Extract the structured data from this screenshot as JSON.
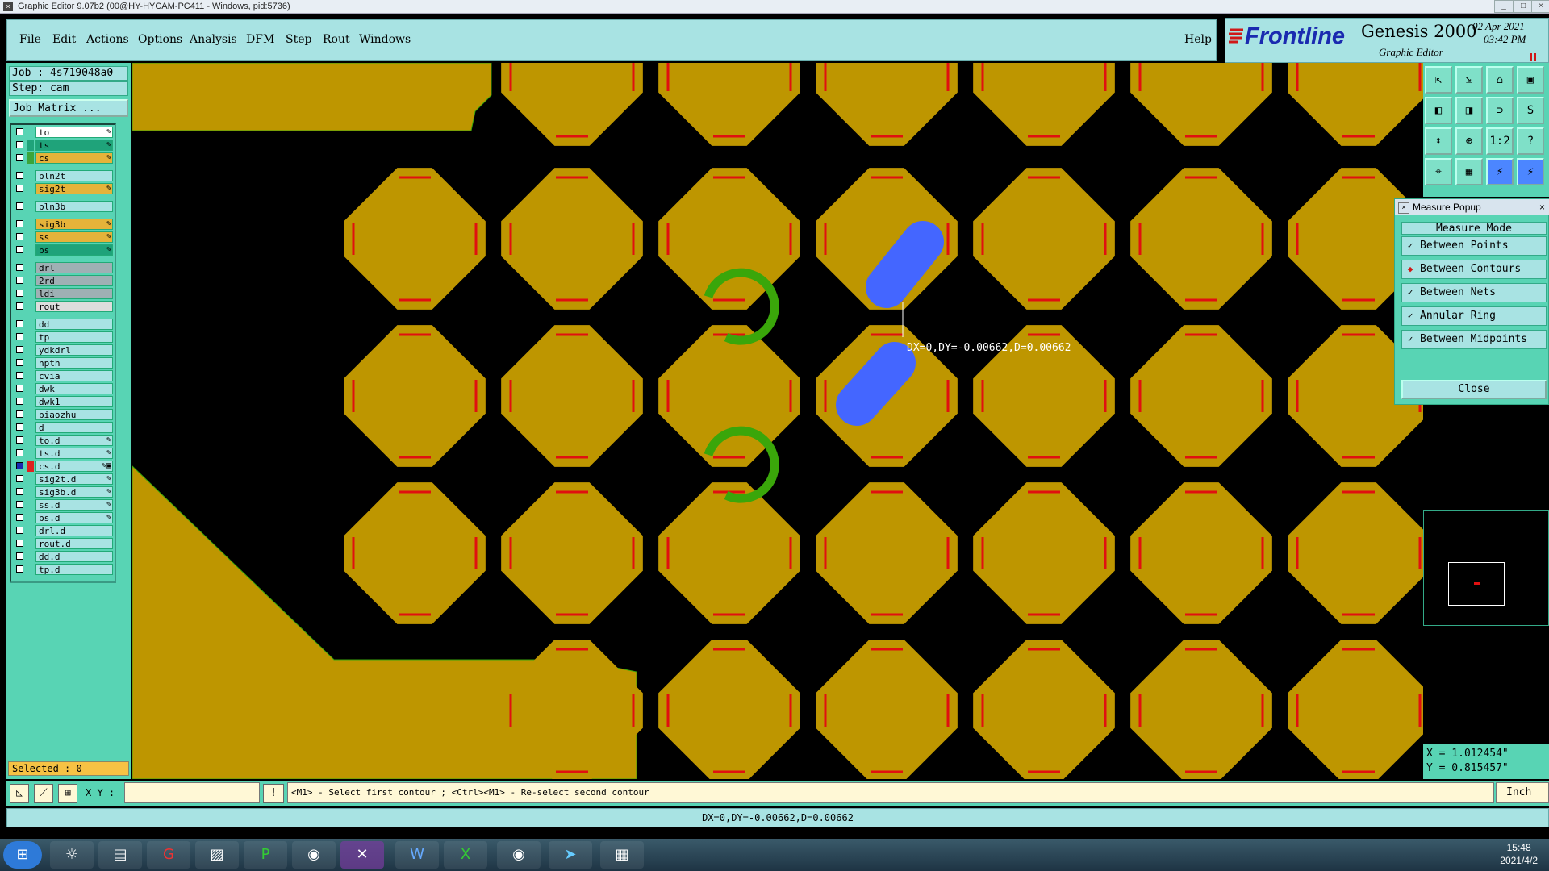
{
  "titlebar": {
    "title": "Graphic Editor 9.07b2 (00@HY-HYCAM-PC411 - Windows, pid:5736)"
  },
  "menu": [
    "File",
    "Edit",
    "Actions",
    "Options",
    "Analysis",
    "DFM",
    "Step",
    "Rout",
    "Windows"
  ],
  "help_label": "Help",
  "logo": {
    "brand": "Frontline",
    "product": "Genesis 2000",
    "subtitle": "Graphic Editor",
    "date": "02 Apr 2021",
    "time": "03:42 PM"
  },
  "job": {
    "job_line": "Job : 4s719048a0",
    "step_line": "Step: cam",
    "matrix_button": "Job Matrix ..."
  },
  "layers": [
    {
      "name": "to",
      "bg": "#ffffff",
      "swatch": "",
      "mark": "✎"
    },
    {
      "name": "ts",
      "bg": "#1fa37a",
      "swatch": "#1fa37a",
      "mark": "✎"
    },
    {
      "name": "cs",
      "bg": "#e5b33a",
      "swatch": "#3aa53a",
      "mark": "✎"
    },
    {
      "name": "pln2t",
      "bg": "#a8e3e3",
      "swatch": "",
      "mark": ""
    },
    {
      "name": "sig2t",
      "bg": "#e5b33a",
      "swatch": "",
      "mark": "✎"
    },
    {
      "name": "pln3b",
      "bg": "#a8e3e3",
      "swatch": "",
      "mark": ""
    },
    {
      "name": "sig3b",
      "bg": "#e5b33a",
      "swatch": "",
      "mark": "✎"
    },
    {
      "name": "ss",
      "bg": "#e5b33a",
      "swatch": "",
      "mark": "✎"
    },
    {
      "name": "bs",
      "bg": "#1fa37a",
      "swatch": "",
      "mark": "✎"
    },
    {
      "name": "drl",
      "bg": "#9fb0b4",
      "swatch": "",
      "mark": ""
    },
    {
      "name": "2rd",
      "bg": "#9fb0b4",
      "swatch": "",
      "mark": ""
    },
    {
      "name": "ldi",
      "bg": "#9fb0b4",
      "swatch": "",
      "mark": ""
    },
    {
      "name": "rout",
      "bg": "#dddddd",
      "swatch": "",
      "mark": ""
    },
    {
      "name": "dd",
      "bg": "#a8e3e3",
      "swatch": "",
      "mark": ""
    },
    {
      "name": "tp",
      "bg": "#a8e3e3",
      "swatch": "",
      "mark": ""
    },
    {
      "name": "ydkdrl",
      "bg": "#a8e3e3",
      "swatch": "",
      "mark": ""
    },
    {
      "name": "npth",
      "bg": "#a8e3e3",
      "swatch": "",
      "mark": ""
    },
    {
      "name": "cvia",
      "bg": "#a8e3e3",
      "swatch": "",
      "mark": ""
    },
    {
      "name": "dwk",
      "bg": "#a8e3e3",
      "swatch": "",
      "mark": ""
    },
    {
      "name": "dwk1",
      "bg": "#a8e3e3",
      "swatch": "",
      "mark": ""
    },
    {
      "name": "biaozhu",
      "bg": "#a8e3e3",
      "swatch": "",
      "mark": ""
    },
    {
      "name": "d",
      "bg": "#a8e3e3",
      "swatch": "",
      "mark": ""
    },
    {
      "name": "to.d",
      "bg": "#a8e3e3",
      "swatch": "",
      "mark": "✎"
    },
    {
      "name": "ts.d",
      "bg": "#a8e3e3",
      "swatch": "",
      "mark": "✎"
    },
    {
      "name": "cs.d",
      "bg": "#a8e3e3",
      "swatch": "#e02020",
      "mark": "✎▣"
    },
    {
      "name": "sig2t.d",
      "bg": "#a8e3e3",
      "swatch": "",
      "mark": "✎"
    },
    {
      "name": "sig3b.d",
      "bg": "#a8e3e3",
      "swatch": "",
      "mark": "✎"
    },
    {
      "name": "ss.d",
      "bg": "#a8e3e3",
      "swatch": "",
      "mark": "✎"
    },
    {
      "name": "bs.d",
      "bg": "#a8e3e3",
      "swatch": "",
      "mark": "✎"
    },
    {
      "name": "drl.d",
      "bg": "#a8e3e3",
      "swatch": "",
      "mark": ""
    },
    {
      "name": "rout.d",
      "bg": "#a8e3e3",
      "swatch": "",
      "mark": ""
    },
    {
      "name": "dd.d",
      "bg": "#a8e3e3",
      "swatch": "",
      "mark": ""
    },
    {
      "name": "tp.d",
      "bg": "#a8e3e3",
      "swatch": "",
      "mark": ""
    }
  ],
  "selected_label": "Selected : 0",
  "measurement_label": "DX=0,DY=-0.00662,D=0.00662",
  "measure_popup": {
    "title": "Measure Popup",
    "mode_header": "Measure Mode",
    "options": [
      {
        "label": "Between Points",
        "active": false
      },
      {
        "label": "Between Contours",
        "active": true
      },
      {
        "label": "Between Nets",
        "active": false
      },
      {
        "label": "Annular Ring",
        "active": false
      },
      {
        "label": "Between Midpoints",
        "active": false
      }
    ],
    "close_label": "Close"
  },
  "coords": {
    "x": "X = 1.012454\"",
    "y": "Y = 0.815457\""
  },
  "cmd": {
    "xy_label": "X Y :",
    "xy_value": "",
    "prompt": "<M1> - Select first contour ; <Ctrl><M1> - Re-select second contour",
    "units": "Inch"
  },
  "status": "DX=0,DY=-0.00662,D=0.00662",
  "taskbar": {
    "time": "15:48",
    "date": "2021/4/2"
  },
  "colors": {
    "pad": "#be9600",
    "pad_edge": "#e01010",
    "selected": "#4466ff",
    "ring": "#3aa60a",
    "panel": "#58d4b4",
    "menu_bg": "#a8e3e3"
  },
  "icons": [
    "windows-start-icon",
    "word-icon",
    "excel-icon",
    "save-icon",
    "close-icon"
  ]
}
